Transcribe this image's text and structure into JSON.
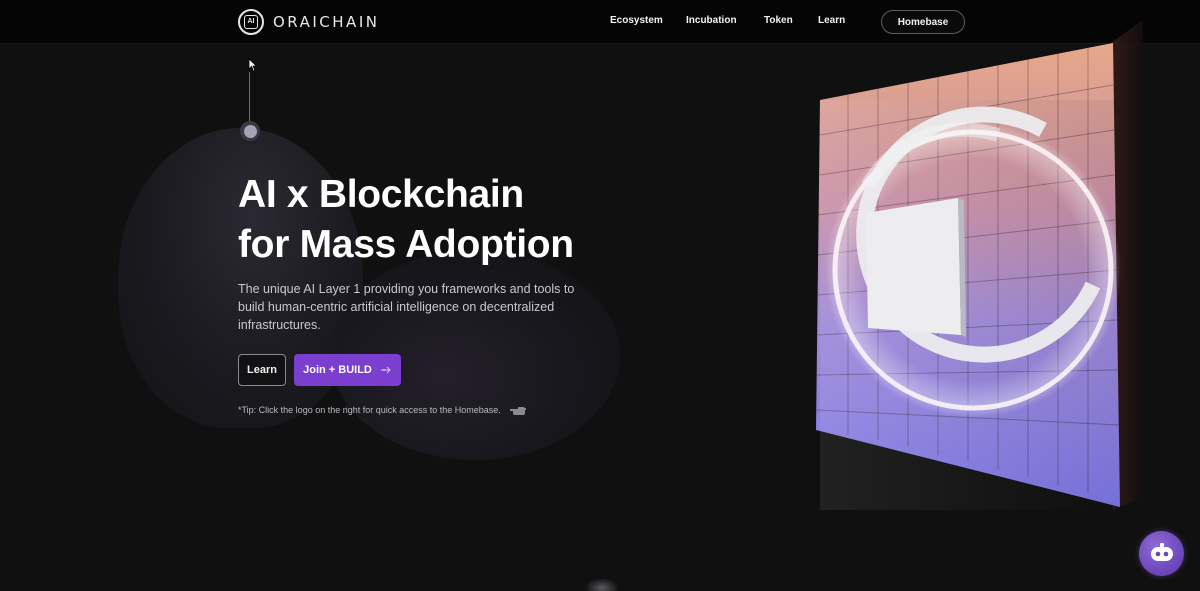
{
  "nav": {
    "logo_mark": "AI",
    "brand": "ORAICHAIN",
    "links": [
      "Ecosystem",
      "Incubation",
      "Token",
      "Learn"
    ],
    "homebase_label": "Homebase"
  },
  "hero": {
    "title_line1": "AI x Blockchain",
    "title_line2": "for Mass Adoption",
    "description": "The unique AI Layer 1 providing you frameworks and tools to build human-centric artificial intelligence on decentralized infrastructures.",
    "learn_label": "Learn",
    "join_label": "Join + BUILD",
    "tip": "*Tip: Click the logo on the right for quick access to the Homebase."
  },
  "colors": {
    "accent": "#7b3fd0",
    "background": "#101011",
    "nav_background": "#050505",
    "chat_bubble": "#6a45b8"
  },
  "icons": {
    "arrow_icon": "sparkle-arrow-icon",
    "tip_icon": "pointing-hand-icon",
    "chat_icon": "robot-icon",
    "cursor": "mouse-pointer-icon"
  }
}
